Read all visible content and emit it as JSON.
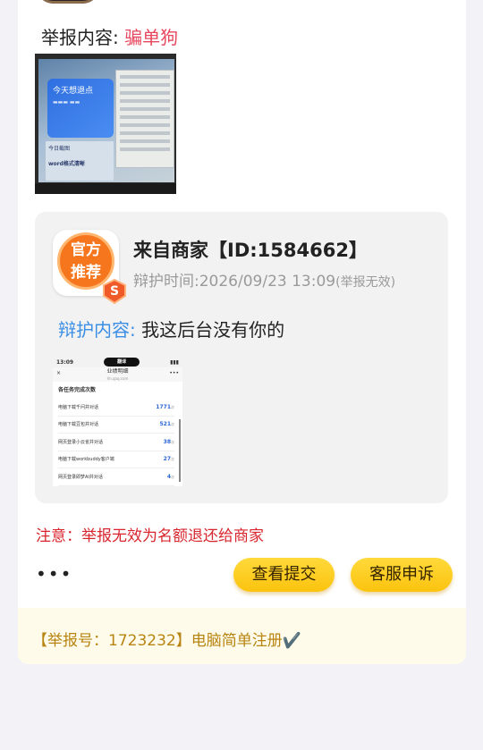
{
  "report": {
    "content_label": "举报内容:",
    "content_value": "骗单狗"
  },
  "report_image_1": {
    "panel_title": "今天想退点",
    "panel_lines": [
      "今日截图",
      "word格式清晰"
    ]
  },
  "defense": {
    "badge_line1": "官方",
    "badge_line2": "推荐",
    "badge_icon_text": "S",
    "merchant": "来自商家【ID:1584662】",
    "time_label": "辩护时间:2026/09/23 13:09",
    "time_note": "(举报无效)",
    "content_label": "辩护内容:",
    "content_value": "我这后台没有你的"
  },
  "defense_image": {
    "status_time": "13:09",
    "status_pill": "翻译",
    "title": "业绩明细",
    "subtitle": "hh.qaq.com",
    "close": "×",
    "menu": "•••",
    "list_title": "各任务完成次数",
    "items": [
      {
        "name": "电脑下载千问并对话",
        "value": "1771",
        "unit": "次"
      },
      {
        "name": "电脑下载豆包并对话",
        "value": "521",
        "unit": "次"
      },
      {
        "name": "网页登录小云雀并对话",
        "value": "38",
        "unit": "次"
      },
      {
        "name": "电脑下载workbuddy客户端",
        "value": "27",
        "unit": "次"
      },
      {
        "name": "网页登录即梦AI并对话",
        "value": "4",
        "unit": "次"
      }
    ]
  },
  "notice": "注意：举报无效为名额退还给商家",
  "actions": {
    "more": "•••",
    "view_submission": "查看提交",
    "customer_service": "客服申诉"
  },
  "footer": {
    "text": "【举报号：1723232】电脑简单注册",
    "check": "✔️"
  },
  "colors": {
    "accent_red": "#e7475e",
    "notice_red": "#d8262e",
    "link_blue": "#3a8ee6",
    "button_yellow": "#fbc30e",
    "footer_text": "#b88411"
  }
}
